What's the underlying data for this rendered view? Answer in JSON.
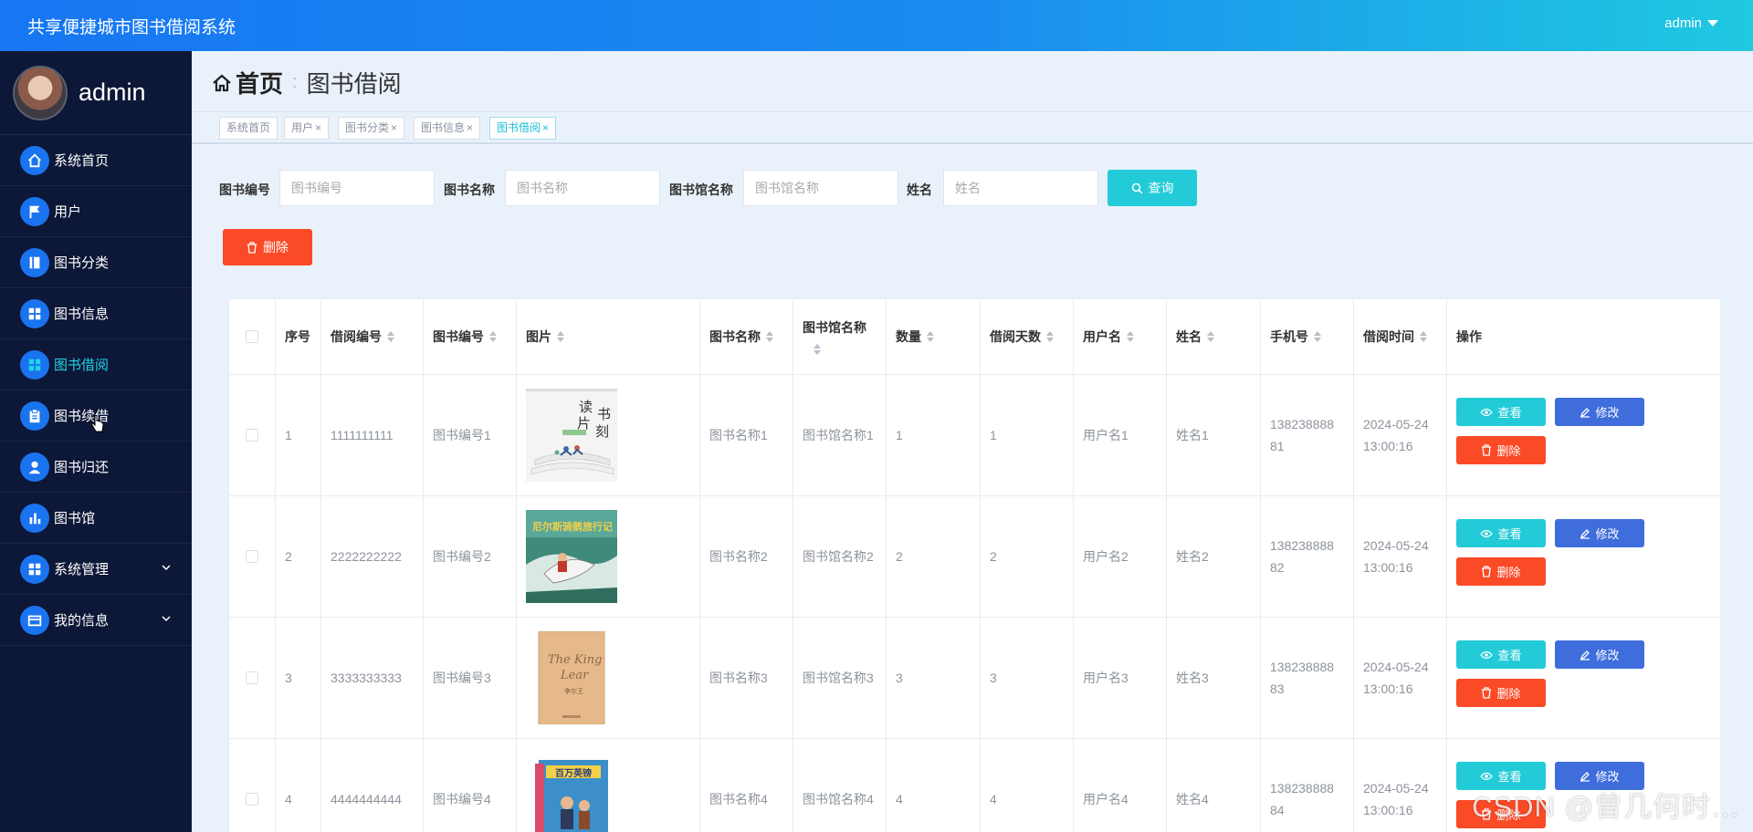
{
  "topbar": {
    "title": "共享便捷城市图书借阅系统",
    "user": "admin"
  },
  "sidebar": {
    "username": "admin",
    "items": [
      {
        "label": "系统首页",
        "icon": "home-icon"
      },
      {
        "label": "用户",
        "icon": "flag-icon"
      },
      {
        "label": "图书分类",
        "icon": "book-icon"
      },
      {
        "label": "图书信息",
        "icon": "grid-icon"
      },
      {
        "label": "图书借阅",
        "icon": "grid-icon",
        "active": true
      },
      {
        "label": "图书续借",
        "icon": "clipboard-icon"
      },
      {
        "label": "图书归还",
        "icon": "person-icon"
      },
      {
        "label": "图书馆",
        "icon": "bar-chart-icon"
      },
      {
        "label": "系统管理",
        "icon": "grid-icon",
        "expandable": true
      },
      {
        "label": "我的信息",
        "icon": "card-icon",
        "expandable": true
      }
    ]
  },
  "breadcrumb": {
    "home": "首页",
    "current": "图书借阅"
  },
  "tabs": [
    {
      "label": "系统首页",
      "closable": false
    },
    {
      "label": "用户",
      "closable": true
    },
    {
      "label": "图书分类",
      "closable": true
    },
    {
      "label": "图书信息",
      "closable": true
    },
    {
      "label": "图书借阅",
      "closable": true,
      "active": true
    }
  ],
  "search": {
    "fields": [
      {
        "label": "图书编号",
        "placeholder": "图书编号"
      },
      {
        "label": "图书名称",
        "placeholder": "图书名称"
      },
      {
        "label": "图书馆名称",
        "placeholder": "图书馆名称"
      },
      {
        "label": "姓名",
        "placeholder": "姓名"
      }
    ],
    "query_label": "查询",
    "delete_label": "删除"
  },
  "table": {
    "columns": [
      "序号",
      "借阅编号",
      "图书编号",
      "图片",
      "图书名称",
      "图书馆名称",
      "数量",
      "借阅天数",
      "用户名",
      "姓名",
      "手机号",
      "借阅时间",
      "操作"
    ],
    "rows": [
      {
        "idx": "1",
        "borrow_no": "1111111111",
        "book_no": "图书编号1",
        "book_name": "图书名称1",
        "library": "图书馆名称1",
        "qty": "1",
        "days": "1",
        "username": "用户名1",
        "name": "姓名1",
        "phone1": "138238888",
        "phone2": "81",
        "date": "2024-05-24",
        "time": "13:00:16",
        "cover": "reading-moment"
      },
      {
        "idx": "2",
        "borrow_no": "2222222222",
        "book_no": "图书编号2",
        "book_name": "图书名称2",
        "library": "图书馆名称2",
        "qty": "2",
        "days": "2",
        "username": "用户名2",
        "name": "姓名2",
        "phone1": "138238888",
        "phone2": "82",
        "date": "2024-05-24",
        "time": "13:00:16",
        "cover": "nils-goose"
      },
      {
        "idx": "3",
        "borrow_no": "3333333333",
        "book_no": "图书编号3",
        "book_name": "图书名称3",
        "library": "图书馆名称3",
        "qty": "3",
        "days": "3",
        "username": "用户名3",
        "name": "姓名3",
        "phone1": "138238888",
        "phone2": "83",
        "date": "2024-05-24",
        "time": "13:00:16",
        "cover": "king-lear"
      },
      {
        "idx": "4",
        "borrow_no": "4444444444",
        "book_no": "图书编号4",
        "book_name": "图书名称4",
        "library": "图书馆名称4",
        "qty": "4",
        "days": "4",
        "username": "用户名4",
        "name": "姓名4",
        "phone1": "138238888",
        "phone2": "84",
        "date": "2024-05-24",
        "time": "13:00:16",
        "cover": "encyclopedia"
      }
    ],
    "actions": {
      "view": "查看",
      "edit": "修改",
      "delete": "删除"
    }
  },
  "covers": {
    "reading": {
      "line1": "读",
      "line2": "书",
      "line3": "片",
      "line4": "刻"
    },
    "nils": "尼尔斯骑鹅旅行记",
    "lear": {
      "title1": "The King",
      "title2": "Lear",
      "cn": "李尔王"
    },
    "ency": "百万英镑"
  },
  "watermark": "CSDN @曾几何时…"
}
